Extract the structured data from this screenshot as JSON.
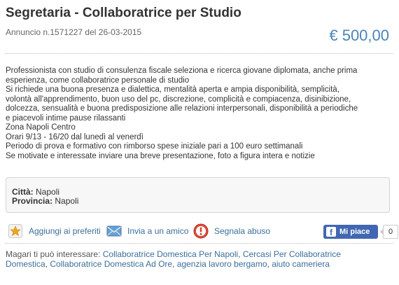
{
  "listing": {
    "title": "Segretaria - Collaboratrice per Studio",
    "ad_meta": "Annuncio n.1571227 del 26-03-2015",
    "price": "€ 500,00",
    "description_lines": [
      "Professionista con studio di consulenza fiscale seleziona e ricerca giovane diplomata, anche prima",
      "esperienza, come collaboratrice personale di studio",
      "Si richiede una buona presenza e dialettica, mentalità aperta e ampia disponibilità, semplicità,",
      "volontà all'apprendimento, buon uso del pc, discrezione, complicità e compiacenza, disinibizione,",
      "dolcezza, sensualità e buona predisposizione alle relazioni interpersonali, disponibilità a periodiche",
      "e piacevoli intime pause rilassanti",
      "Zona Napoli Centro",
      "Orari 9/13 - 16/20 dal lunedì al venerdì",
      "Periodo di prova e formativo con rimborso spese iniziale pari a 100 euro settimanali",
      "Se motivate e interessate inviare una breve presentazione, foto a figura intera e notizie"
    ]
  },
  "info": {
    "city_label": "Città:",
    "city_value": "Napoli",
    "province_label": "Provincia:",
    "province_value": "Napoli"
  },
  "actions": {
    "favorites": "Aggiungi ai preferiti",
    "send_friend": "Invia a un amico",
    "report": "Segnala abuso",
    "fb_like": "Mi piace",
    "fb_count": "0"
  },
  "related": {
    "prefix": "Magari ti può interessare:",
    "links": [
      "Collaboratrice Domestica Per Napoli",
      "Cercasi Per Collaboratrice Domestica",
      "Collaboratrice Domestica Ad Ore",
      "agenzia lavoro bergamo",
      "aiuto cameriera"
    ]
  },
  "colors": {
    "price": "#4a84b8",
    "link": "#3a6e9c",
    "facebook": "#4267b2"
  }
}
